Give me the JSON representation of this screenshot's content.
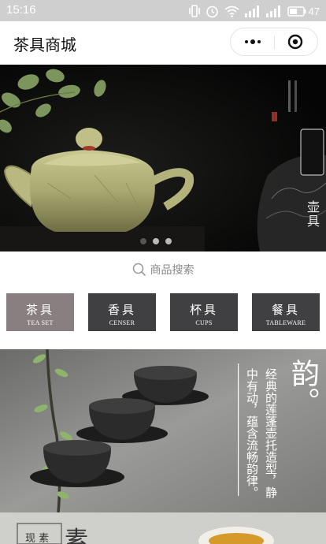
{
  "status_bar": {
    "time": "15:16",
    "battery": "47"
  },
  "nav": {
    "title": "茶具商城"
  },
  "banner": {
    "label": "壶具",
    "slides": 3,
    "active_slide": 1
  },
  "search": {
    "placeholder": "商品搜索"
  },
  "categories": [
    {
      "cn": "茶具",
      "en": "TEA SET",
      "bg": "#8a7f80"
    },
    {
      "cn": "香具",
      "en": "CENSER",
      "bg": "#404042"
    },
    {
      "cn": "杯具",
      "en": "CUPS",
      "bg": "#404042"
    },
    {
      "cn": "餐具",
      "en": "TABLEWARE",
      "bg": "#404042"
    }
  ],
  "promo": {
    "headline": "韵。",
    "line1": "经典的莲蓬壶托造型，静",
    "line2": "中有动，蕴含流畅韵律。"
  },
  "promo2": {
    "tag": "现 素",
    "headline": "素"
  },
  "colors": {
    "statusbar": "#cfcfcf",
    "active_category": "#8a7f80",
    "category": "#404042"
  }
}
